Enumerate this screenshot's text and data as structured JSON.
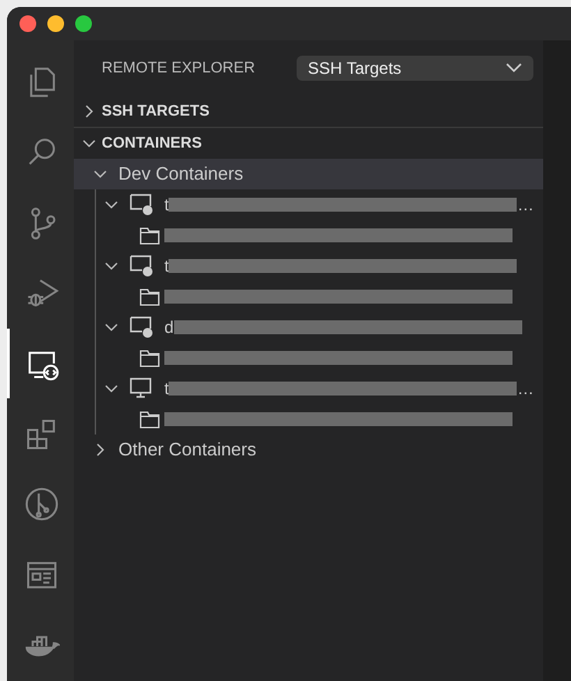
{
  "activity_bar": [
    {
      "kind": "files",
      "selected": false
    },
    {
      "kind": "search",
      "selected": false
    },
    {
      "kind": "scm",
      "selected": false
    },
    {
      "kind": "debug",
      "selected": false
    },
    {
      "kind": "remote",
      "selected": true
    },
    {
      "kind": "extensions",
      "selected": false
    },
    {
      "kind": "pr",
      "selected": false
    },
    {
      "kind": "webview",
      "selected": false
    },
    {
      "kind": "docker",
      "selected": false
    }
  ],
  "header": {
    "title": "REMOTE EXPLORER",
    "dropdown": "SSH Targets"
  },
  "sections": [
    {
      "title": "SSH TARGETS",
      "expanded": false
    },
    {
      "title": "CONTAINERS",
      "expanded": true,
      "groups": [
        {
          "label": "Dev Containers",
          "expanded": true,
          "selected": true,
          "containers": [
            {
              "name": "t",
              "running": true,
              "tail": "…"
            },
            {
              "name": "t",
              "running": true
            },
            {
              "name": "d",
              "running": true
            },
            {
              "name": "t",
              "running": false,
              "tail": "…"
            }
          ]
        },
        {
          "label": "Other Containers",
          "expanded": false,
          "selected": false
        }
      ]
    }
  ]
}
